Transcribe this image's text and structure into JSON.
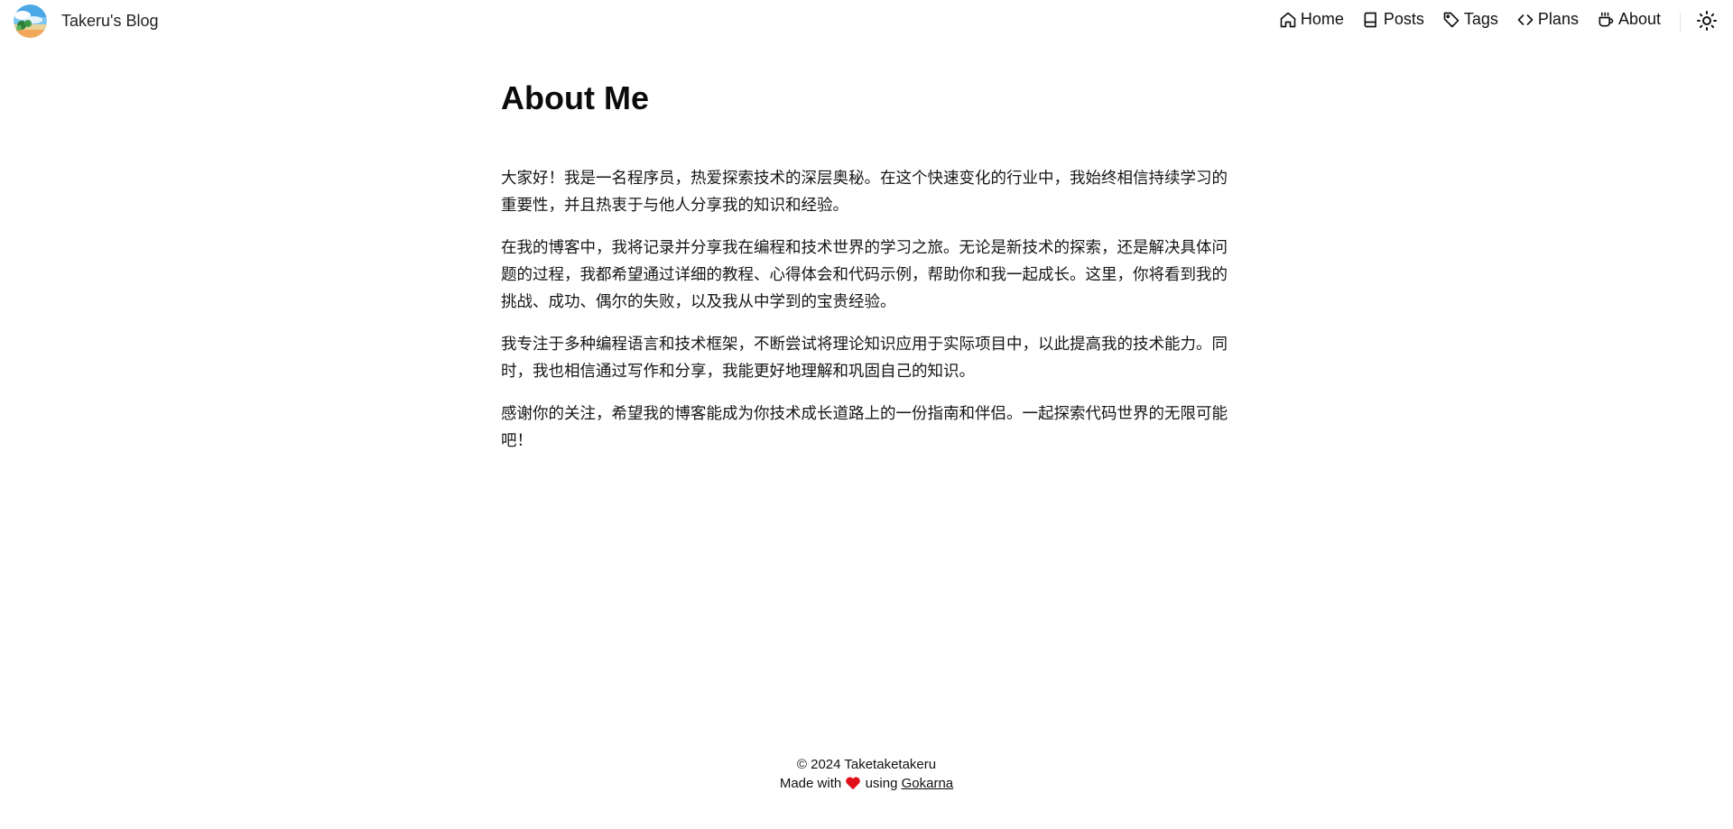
{
  "header": {
    "site_title": "Takeru's Blog",
    "nav": [
      {
        "label": "Home",
        "icon": "home-icon"
      },
      {
        "label": "Posts",
        "icon": "book-icon"
      },
      {
        "label": "Tags",
        "icon": "tag-icon"
      },
      {
        "label": "Plans",
        "icon": "code-icon"
      },
      {
        "label": "About",
        "icon": "coffee-icon"
      }
    ],
    "theme_toggle_icon": "sun-icon"
  },
  "main": {
    "title": "About Me",
    "paragraphs": [
      "大家好！我是一名程序员，热爱探索技术的深层奥秘。在这个快速变化的行业中，我始终相信持续学习的重要性，并且热衷于与他人分享我的知识和经验。",
      "在我的博客中，我将记录并分享我在编程和技术世界的学习之旅。无论是新技术的探索，还是解决具体问题的过程，我都希望通过详细的教程、心得体会和代码示例，帮助你和我一起成长。这里，你将看到我的挑战、成功、偶尔的失败，以及我从中学到的宝贵经验。",
      "我专注于多种编程语言和技术框架，不断尝试将理论知识应用于实际项目中，以此提高我的技术能力。同时，我也相信通过写作和分享，我能更好地理解和巩固自己的知识。",
      "感谢你的关注，希望我的博客能成为你技术成长道路上的一份指南和伴侣。一起探索代码世界的无限可能吧！"
    ]
  },
  "footer": {
    "copyright": "© 2024 Taketaketakeru",
    "made_with": "Made with",
    "using": "using",
    "link_label": "Gokarna",
    "heart_color": "#e0101b"
  }
}
